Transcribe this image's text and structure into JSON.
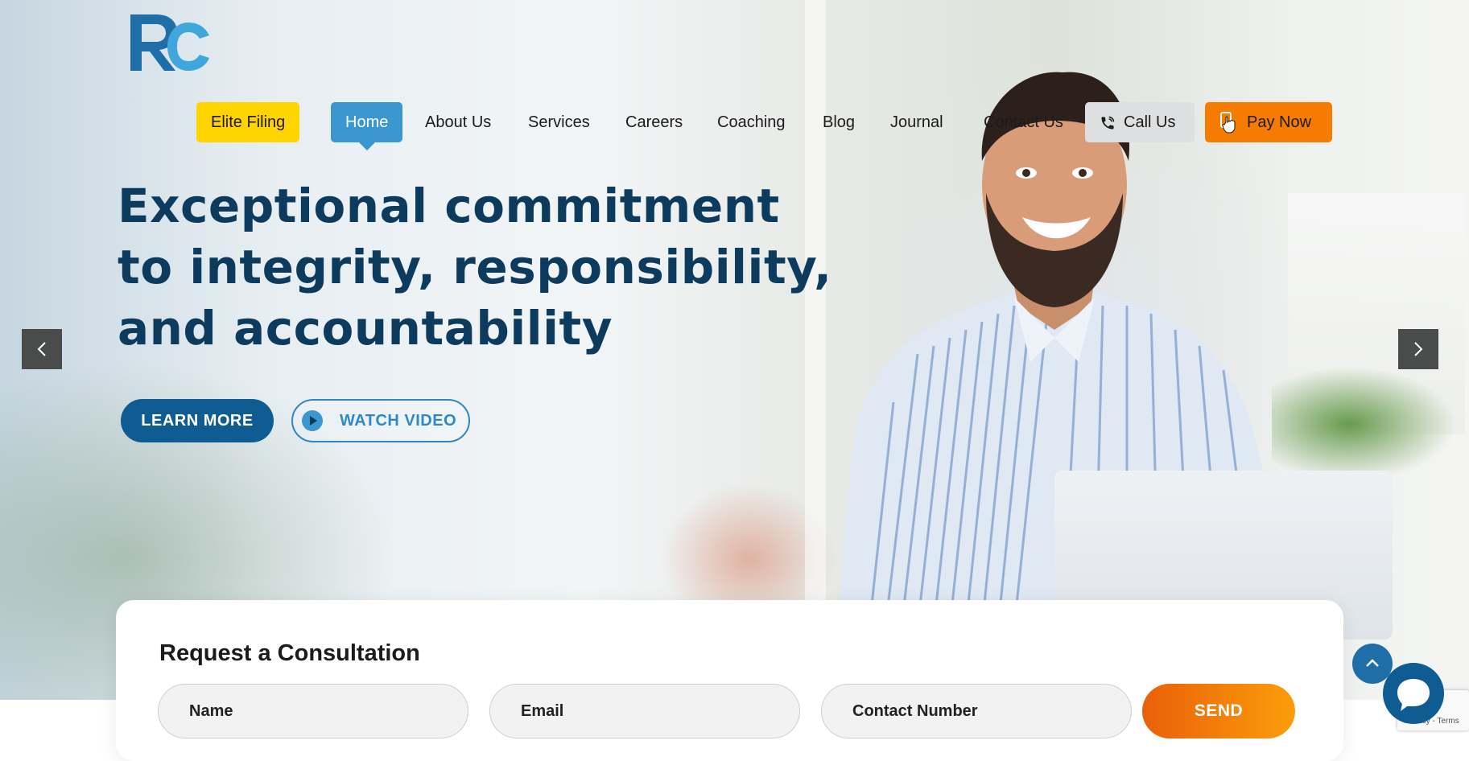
{
  "brand": {
    "logo_text": "RC",
    "logo_colors": [
      "#1f6ea8",
      "#3fa7dc"
    ]
  },
  "nav": {
    "elite_filing": "Elite Filing",
    "home": "Home",
    "about": "About Us",
    "services": "Services",
    "careers": "Careers",
    "coaching": "Coaching",
    "blog": "Blog",
    "journal": "Journal",
    "contact": "Contact Us",
    "call": "Call Us",
    "pay": "Pay Now",
    "active": "Home",
    "call_icon": "phone-icon",
    "pay_icon": "hand-card-icon"
  },
  "hero": {
    "headline_line1": "Exceptional commitment",
    "headline_line2": "to integrity, responsibility,",
    "headline_line3": "and accountability",
    "learn_more": "LEARN MORE",
    "watch_video": "WATCH VIDEO",
    "prev_icon": "chevron-left-icon",
    "next_icon": "chevron-right-icon"
  },
  "consultation": {
    "title": "Request a Consultation",
    "name_placeholder": "Name",
    "email_placeholder": "Email",
    "contact_placeholder": "Contact Number",
    "send": "SEND"
  },
  "widgets": {
    "scroll_top_icon": "chevron-up-icon",
    "chat_icon": "chat-bubble-icon",
    "recaptcha_text": "Privacy - Terms"
  },
  "colors": {
    "primary": "#0f5c93",
    "accent_blue": "#3a97cf",
    "yellow": "#ffd400",
    "orange": "#f57c00",
    "headline": "#0d3b5e"
  }
}
